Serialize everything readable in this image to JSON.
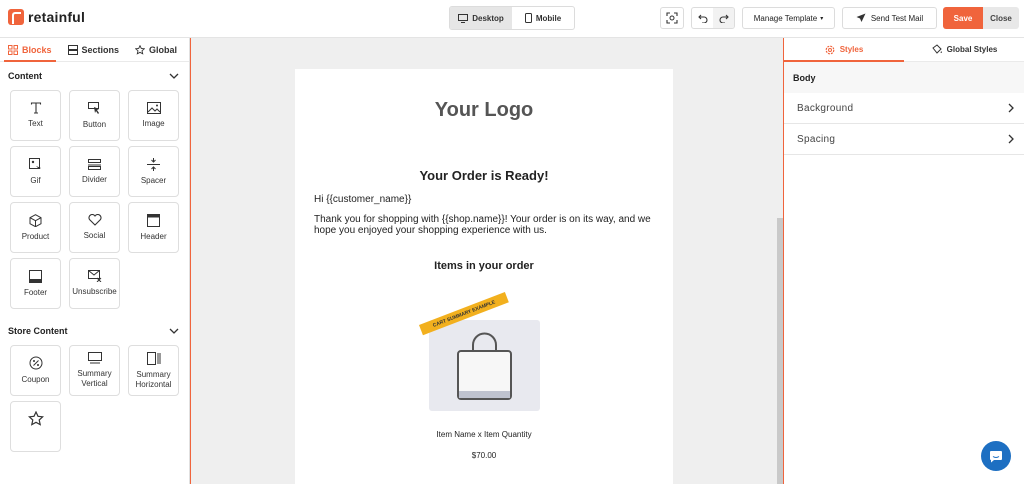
{
  "app": {
    "brand": "retainful"
  },
  "topbar": {
    "device_desktop": "Desktop",
    "device_mobile": "Mobile",
    "manage_template": "Manage Template",
    "send_test_mail": "Send Test Mail",
    "save": "Save",
    "close": "Close"
  },
  "left": {
    "tabs": [
      "Blocks",
      "Sections",
      "Global"
    ],
    "content_title": "Content",
    "content_blocks": [
      "Text",
      "Button",
      "Image",
      "Gif",
      "Divider",
      "Spacer",
      "Product",
      "Social",
      "Header",
      "Footer",
      "Unsubscribe"
    ],
    "store_title": "Store Content",
    "store_blocks": [
      "Coupon",
      "Summary Vertical",
      "Summary Horizontal"
    ]
  },
  "email": {
    "logo": "Your Logo",
    "title": "Your Order is Ready!",
    "greeting": "Hi {{customer_name}}",
    "body": "Thank you for shopping with {{shop.name}}! Your order is on its way, and we hope you enjoyed your shopping experience with us.",
    "items_heading": "Items in your order",
    "ribbon": "CART SUMMARY EXAMPLE",
    "item_name": "Item Name x Item Quantity",
    "item_price": "$70.00"
  },
  "right": {
    "tabs": [
      "Styles",
      "Global Styles"
    ],
    "section": "Body",
    "accordions": [
      "Background",
      "Spacing"
    ]
  },
  "colors": {
    "accent": "#f0643c",
    "chat": "#1d6fc2",
    "ribbon": "#f2b01e"
  }
}
